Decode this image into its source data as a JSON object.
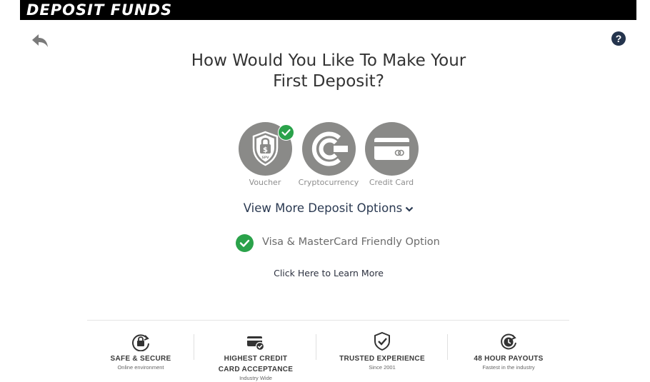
{
  "header": {
    "title": "DEPOSIT FUNDS"
  },
  "nav": {
    "help_label": "?"
  },
  "main": {
    "question_line1": "How Would You Like To Make Your",
    "question_line2": "First Deposit?",
    "options": [
      {
        "label": "Voucher",
        "icon": "voucher-shield-lock-icon",
        "selected": true
      },
      {
        "label": "Cryptocurrency",
        "icon": "crypto-icon",
        "selected": false
      },
      {
        "label": "Credit Card",
        "icon": "credit-card-icon",
        "selected": false
      }
    ],
    "more_options_label": "View More Deposit Options",
    "visa_text": "Visa & MasterCard Friendly Option",
    "learn_more_label": "Click Here to Learn More"
  },
  "features": [
    {
      "title": "SAFE & SECURE",
      "subtitle": "Online environment",
      "icon": "lock-refresh-icon"
    },
    {
      "title_line1": "HIGHEST CREDIT",
      "title_line2": "CARD ACCEPTANCE",
      "subtitle": "Industry Wide",
      "icon": "card-check-icon"
    },
    {
      "title": "TRUSTED EXPERIENCE",
      "subtitle": "Since 2001",
      "icon": "shield-check-icon"
    },
    {
      "title": "48 HOUR PAYOUTS",
      "subtitle": "Fastest in the industry",
      "icon": "clock-refresh-icon"
    }
  ],
  "colors": {
    "header_bg": "#000000",
    "option_circle": "#8a8a88",
    "accent_green": "#2aa24a",
    "help_bg": "#24344d",
    "link_dark": "#2b3a52"
  }
}
